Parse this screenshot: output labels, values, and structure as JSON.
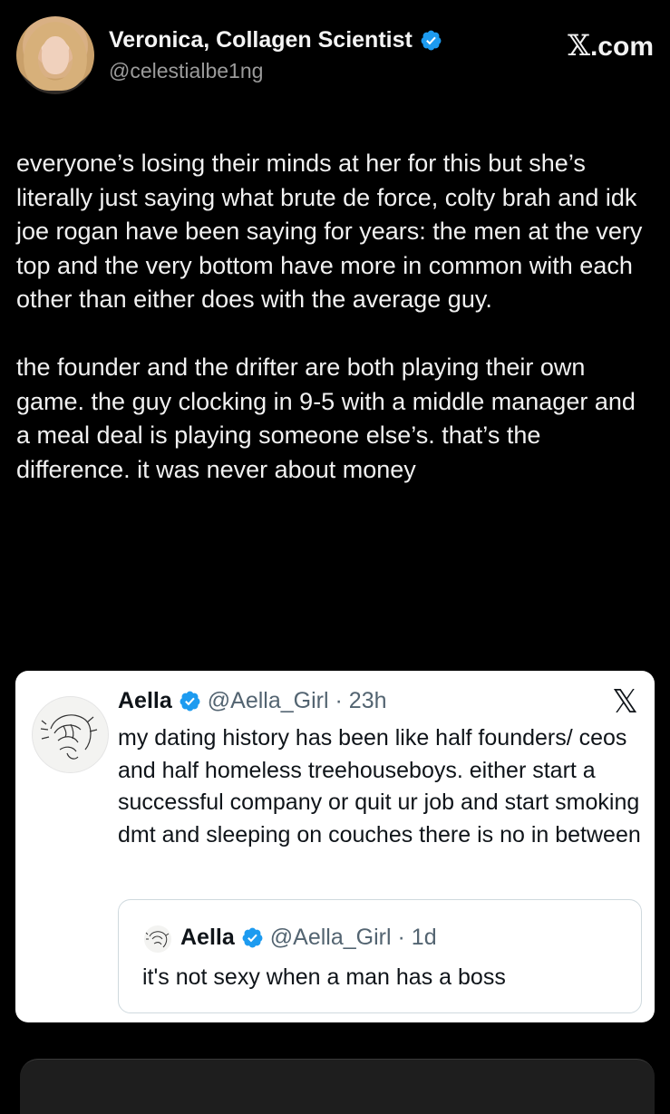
{
  "post": {
    "author_name": "Veronica, Collagen Scientist",
    "author_handle": "@celestialbe1ng",
    "brand": "X.com",
    "text": "everyone’s losing their minds at her for this but she’s literally just saying what brute de force, colty brah and idk joe rogan have been saying for years: the men at the very top and the very bottom have more in common with each other than either does with the average guy.\n\nthe founder and the drifter are both playing their own game. the guy clocking in 9-5 with a middle manager and a meal deal is playing someone else’s. that’s the difference. it was never about money"
  },
  "quote": {
    "author_name": "Aella",
    "author_handle": "@Aella_Girl",
    "time": "· 23h",
    "text": "my dating history has been like half founders/ ceos and half homeless treehouseboys. either start a successful company or quit ur job and start smoking dmt and sleeping on couches there is no in between",
    "nested": {
      "author_name": "Aella",
      "author_handle": "@Aella_Girl",
      "time": "· 1d",
      "text": "it's not sexy when a man has a boss"
    }
  },
  "colors": {
    "verified_blue": "#1d9bf0",
    "background": "#000000",
    "card_background": "#ffffff"
  },
  "icons": {
    "verified": "verified-badge-icon",
    "x_logo": "x-logo-icon"
  }
}
